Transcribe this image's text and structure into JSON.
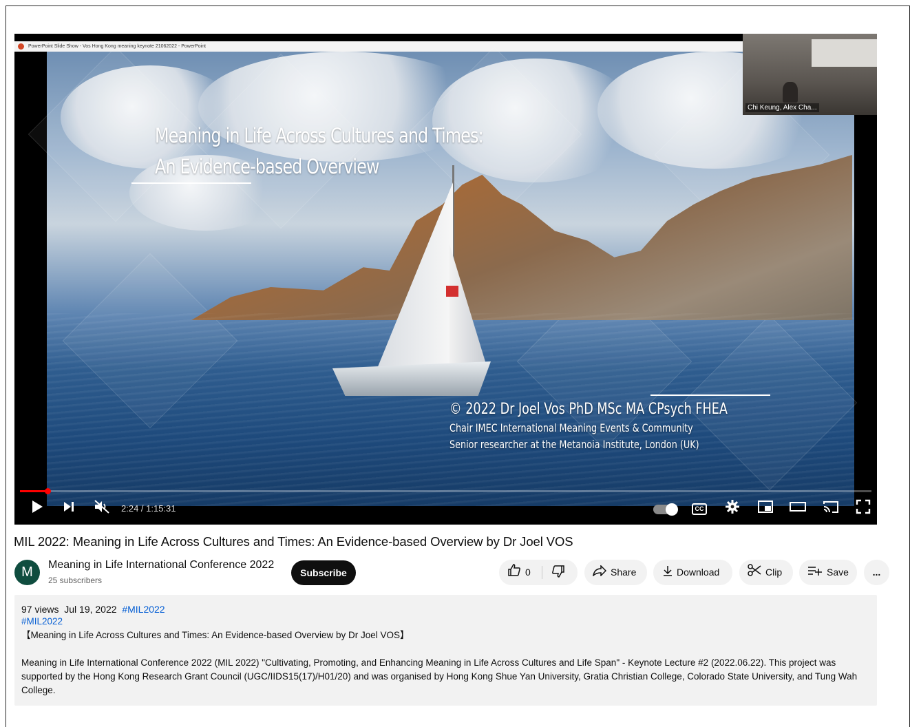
{
  "player": {
    "window_title": "PowerPoint Slide Show  -  Vos Hong Kong meaning keynote 21062022 - PowerPoint",
    "slide_title_line1": "Meaning in Life Across Cultures and Times:",
    "slide_title_line2": "An Evidence-based Overview",
    "credit_line1": "© 2022 Dr Joel Vos PhD MSc MA CPsych FHEA",
    "credit_line2": "Chair IMEC International Meaning Events & Community",
    "credit_line3": "Senior researcher at the Metanoia Institute, London (UK)",
    "camera_label": "Chi Keung, Alex Cha...",
    "time_display": "2:24 / 1:15:31",
    "progress_fraction": 0.032,
    "cc_label": "CC",
    "accent_color": "#ff0000"
  },
  "video": {
    "title": "MIL 2022: Meaning in Life Across Cultures and Times: An Evidence-based Overview by Dr Joel VOS"
  },
  "channel": {
    "avatar_letter": "M",
    "name": "Meaning in Life International Conference 2022",
    "subscribers": "25 subscribers",
    "subscribe_label": "Subscribe"
  },
  "actions": {
    "like_count": "0",
    "share_label": "Share",
    "download_label": "Download",
    "clip_label": "Clip",
    "save_label": "Save",
    "more_label": "..."
  },
  "description": {
    "views": "97 views",
    "date": "Jul 19, 2022",
    "hashtag_inline": "#MIL2022",
    "hashtag_line": "#MIL2022",
    "heading": "【Meaning in Life Across Cultures and Times: An Evidence-based Overview by Dr Joel VOS】",
    "body": "Meaning in Life International Conference 2022 (MIL 2022) \"Cultivating, Promoting, and Enhancing Meaning in Life Across Cultures and Life Span\" - Keynote Lecture #2 (2022.06.22). This project was supported by the Hong Kong Research Grant Council (UGC/IIDS15(17)/H01/20) and was organised by Hong Kong Shue Yan University, Gratia Christian College, Colorado State University, and Tung Wah College."
  }
}
